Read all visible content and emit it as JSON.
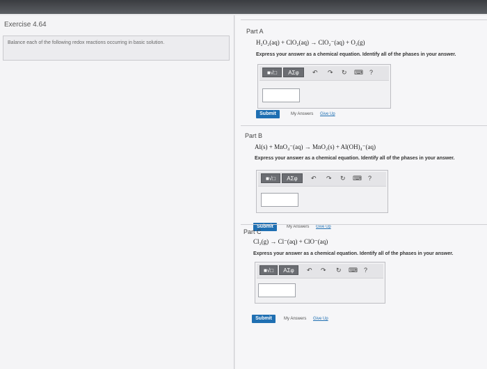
{
  "exercise": {
    "title": "Exercise 4.64",
    "prompt": "Balance each of the following redox reactions occurring in basic solution."
  },
  "toolbar": {
    "template_button": "■√□",
    "symbol_button": "ΑΣφ",
    "undo_icon": "undo-icon",
    "redo_icon": "redo-icon",
    "reset_icon": "reset-icon",
    "keyboard_icon": "keyboard-icon",
    "help_label": "?"
  },
  "parts": [
    {
      "label": "Part A",
      "equation": "H₂O₂(aq) + ClO₂(aq) → ClO₂⁻(aq) + O₂(g)",
      "instruction": "Express your answer as a chemical equation. Identify all of the phases in your answer.",
      "answer": "",
      "submit": "Submit",
      "my_answers": "My Answers",
      "give_up": "Give Up"
    },
    {
      "label": "Part B",
      "equation": "Al(s) + MnO₄⁻(aq) → MnO₂(s) + Al(OH)₄⁻(aq)",
      "instruction": "Express your answer as a chemical equation. Identify all of the phases in your answer.",
      "answer": "",
      "submit": "Submit",
      "my_answers": "My Answers",
      "give_up": "Give Up"
    },
    {
      "label": "Part C",
      "equation": "Cl₂(g) → Cl⁻(aq) + ClO⁻(aq)",
      "instruction": "Express your answer as a chemical equation. Identify all of the phases in your answer.",
      "answer": "",
      "submit": "Submit",
      "my_answers": "My Answers",
      "give_up": "Give Up"
    }
  ]
}
